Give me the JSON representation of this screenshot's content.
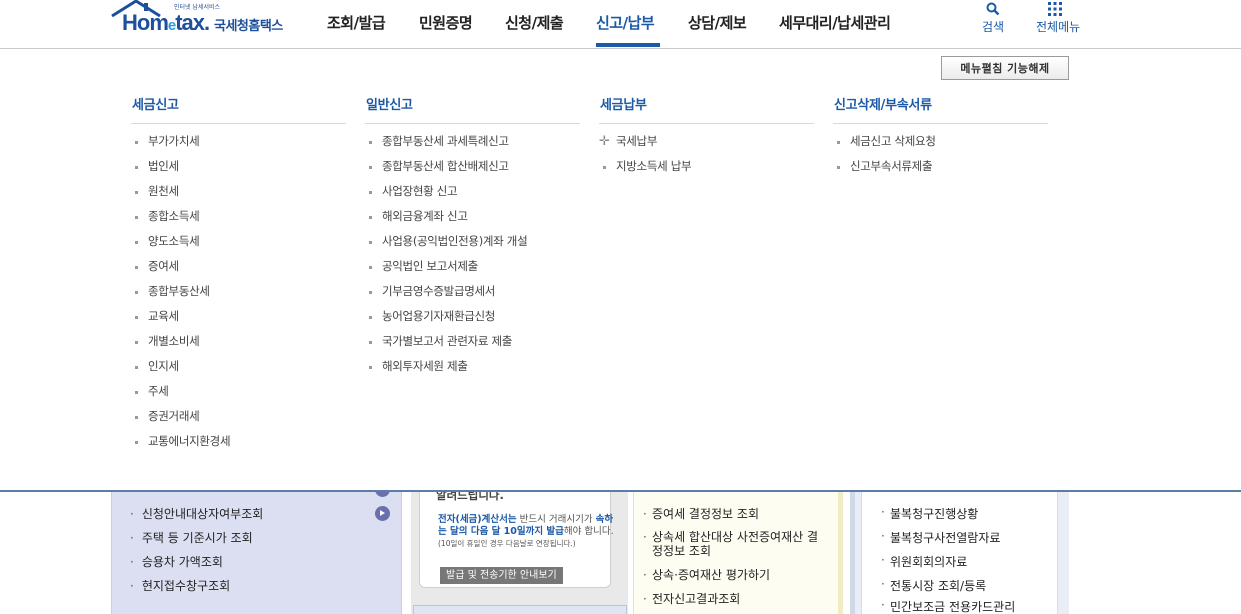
{
  "header": {
    "logo": {
      "tagline": "인터넷 납세서비스",
      "brand_pre": "Hom",
      "brand_e": "e",
      "brand_post": "tax.",
      "brand_kr": "국세청홈택스"
    },
    "nav": [
      {
        "label": "조회/발급"
      },
      {
        "label": "민원증명"
      },
      {
        "label": "신청/제출"
      },
      {
        "label": "신고/납부"
      },
      {
        "label": "상담/제보"
      },
      {
        "label": "세무대리/납세관리"
      }
    ],
    "active_nav": "신고/납부",
    "util": {
      "search_label": "검색",
      "allmenu_label": "전체메뉴"
    }
  },
  "mega_menu": {
    "release_button": "메뉴펼침 기능해제",
    "columns": [
      {
        "title": "세금신고",
        "items": [
          "부가가치세",
          "법인세",
          "원천세",
          "종합소득세",
          "양도소득세",
          "증여세",
          "종합부동산세",
          "교육세",
          "개별소비세",
          "인지세",
          "주세",
          "증권거래세",
          "교통에너지환경세"
        ]
      },
      {
        "title": "일반신고",
        "items": [
          "종합부동산세 과세특례신고",
          "종합부동산세 합산배제신고",
          "사업장현황 신고",
          "해외금융계좌 신고",
          "사업용(공익법인전용)계좌 개설",
          "공익법인 보고서제출",
          "기부금영수증발급명세서",
          "농어업용기자재환급신청",
          "국가별보고서 관련자료 제출",
          "해외투자세원 제출"
        ]
      },
      {
        "title": "세금납부",
        "items": [
          "국세납부",
          "지방소득세 납부"
        ]
      },
      {
        "title": "신고삭제/부속서류",
        "items": [
          "세금신고 삭제요청",
          "신고부속서류제출"
        ]
      }
    ]
  },
  "background": {
    "panel1": [
      "신청안내대상자여부조회",
      "주택 등 기준시가 조회",
      "승용차 가액조회",
      "현지접수창구조회"
    ],
    "panel2": {
      "heading": "알려드립니다.",
      "text_blue": "전자(세금)계산서는",
      "text_rest1": " 반드시 거래시기가 ",
      "text_blue2": "속하는 달의 다음 달 10일까지 발급",
      "text_rest2": "해야 합니다.",
      "note": "(10일이 휴일인 경우 다음날로 연장됩니다.)",
      "button": "발급 및 전송기한 안내보기"
    },
    "panel3": [
      "증여세 결정정보 조회",
      "상속세 합산대상 사전증여재산 결정정보 조회",
      "상속·증여재산 평가하기",
      "전자신고결과조회"
    ],
    "panel4": [
      "불복청구진행상황",
      "불복청구사전열람자료",
      "위원회회의자료",
      "전통시장 조회/등록",
      "민간보조금 전용카드관리"
    ]
  }
}
